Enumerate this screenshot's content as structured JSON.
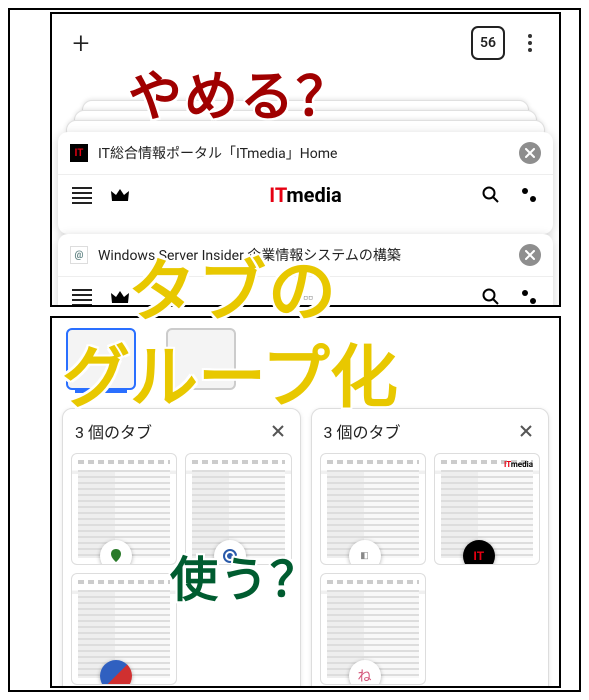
{
  "browser": {
    "tab_count": "56"
  },
  "tabs": [
    {
      "favicon_text": "IT",
      "title": "IT総合情報ポータル「ITmedia」Home",
      "logo_red": "IT",
      "logo_black": "media"
    },
    {
      "favicon_text": "@",
      "title": "Windows Server Insider 企業情報システムの構築"
    }
  ],
  "groups": [
    {
      "title": "3 個のタブ"
    },
    {
      "title": "3 個のタブ"
    }
  ],
  "overlays": {
    "stop": "やめる？",
    "tab": "タブの",
    "group": "グループ化",
    "use": "使う？"
  },
  "badges": {
    "it": "IT",
    "ne": "ね"
  }
}
